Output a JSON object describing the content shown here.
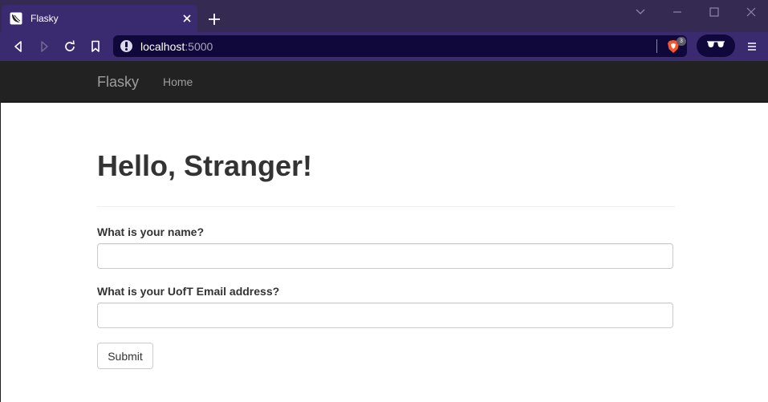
{
  "browser": {
    "tab": {
      "title": "Flasky",
      "favicon": "flask-favicon-icon"
    },
    "url": {
      "host": "localhost",
      "port": ":5000"
    },
    "shield_count": "3",
    "colors": {
      "titlebar": "#352a52",
      "toolbar": "#3a2b70",
      "urlbar": "#10073a"
    }
  },
  "navbar": {
    "brand": "Flasky",
    "links": [
      {
        "label": "Home"
      }
    ]
  },
  "main": {
    "heading": "Hello, Stranger!",
    "form": {
      "name_label": "What is your name?",
      "name_value": "",
      "email_label": "What is your UofT Email address?",
      "email_value": "",
      "submit_label": "Submit"
    }
  }
}
